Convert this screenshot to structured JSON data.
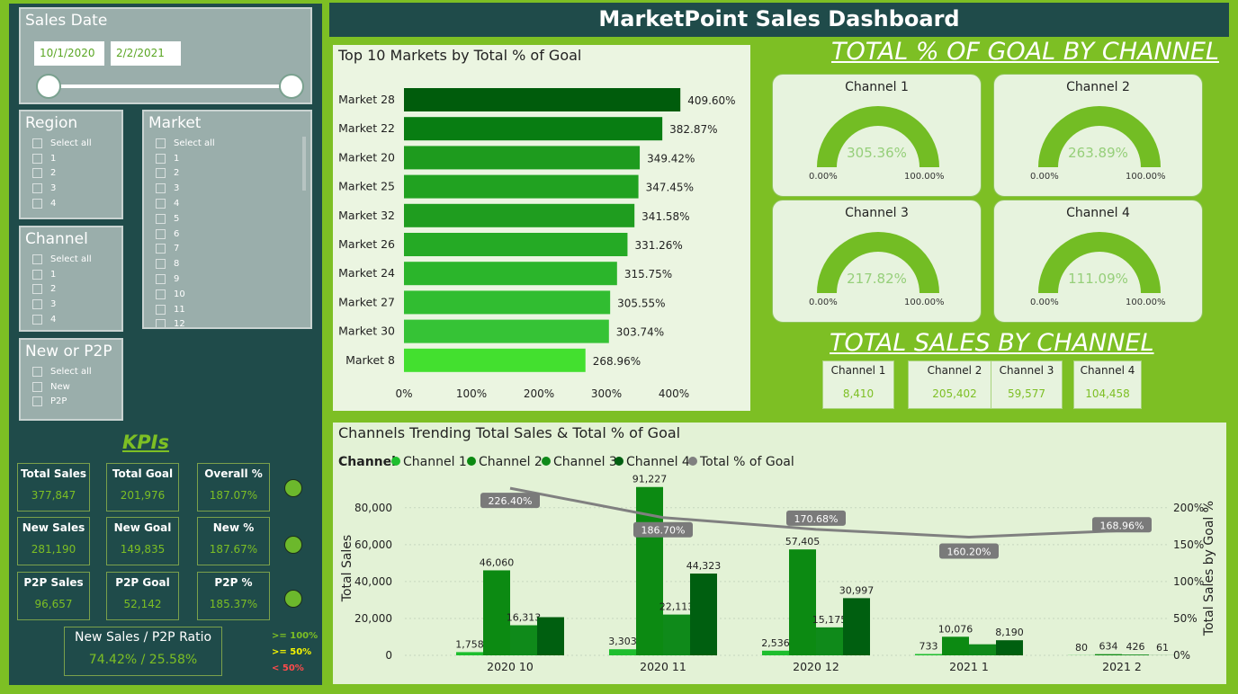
{
  "header": {
    "title": "MarketPoint Sales Dashboard"
  },
  "sales_date": {
    "title": "Sales Date",
    "start": "10/1/2020",
    "end": "2/2/2021"
  },
  "region": {
    "title": "Region",
    "options": [
      "Select all",
      "1",
      "2",
      "3",
      "4"
    ]
  },
  "market": {
    "title": "Market",
    "options": [
      "Select all",
      "1",
      "2",
      "3",
      "4",
      "5",
      "6",
      "7",
      "8",
      "9",
      "10",
      "11",
      "12"
    ]
  },
  "channel": {
    "title": "Channel",
    "options": [
      "Select all",
      "1",
      "2",
      "3",
      "4"
    ]
  },
  "new_p2p": {
    "title": "New or P2P",
    "options": [
      "Select all",
      "New",
      "P2P"
    ]
  },
  "kpis": {
    "title": "KPIs",
    "total_sales_label": "Total Sales",
    "total_sales": "377,847",
    "total_goal_label": "Total Goal",
    "total_goal": "201,976",
    "overall_pct_label": "Overall %",
    "overall_pct": "187.07%",
    "new_sales_label": "New Sales",
    "new_sales": "281,190",
    "new_goal_label": "New Goal",
    "new_goal": "149,835",
    "new_pct_label": "New %",
    "new_pct": "187.67%",
    "p2p_sales_label": "P2P Sales",
    "p2p_sales": "96,657",
    "p2p_goal_label": "P2P Goal",
    "p2p_goal": "52,142",
    "p2p_pct_label": "P2P %",
    "p2p_pct": "185.37%",
    "ratio_label": "New Sales / P2P Ratio",
    "ratio": "74.42% / 25.58%",
    "legend": [
      ">= 100%",
      ">= 50%",
      "< 50%"
    ],
    "legend_colors": [
      "#7dbf24",
      "#f5f500",
      "#ff4b4b"
    ]
  },
  "goal_by_channel": {
    "title": "TOTAL % OF GOAL BY CHANNEL",
    "min_label": "0.00%",
    "max_label": "100.00%",
    "gauges": [
      {
        "name": "Channel 1",
        "value": "305.36%"
      },
      {
        "name": "Channel 2",
        "value": "263.89%"
      },
      {
        "name": "Channel 3",
        "value": "217.82%"
      },
      {
        "name": "Channel 4",
        "value": "111.09%"
      }
    ]
  },
  "sales_by_channel": {
    "title": "TOTAL SALES BY CHANNEL",
    "items": [
      {
        "name": "Channel 1",
        "value": "8,410"
      },
      {
        "name": "Channel 2",
        "value": "205,402"
      },
      {
        "name": "Channel 3",
        "value": "59,577"
      },
      {
        "name": "Channel 4",
        "value": "104,458"
      }
    ]
  },
  "colors": {
    "accent": "#7dbf24",
    "dark": "#1f4b4a",
    "goal_line": "#808080"
  },
  "chart_data": [
    {
      "type": "bar",
      "orientation": "horizontal",
      "title": "Top 10 Markets by Total % of Goal",
      "categories": [
        "Market 28",
        "Market 22",
        "Market 20",
        "Market 25",
        "Market 32",
        "Market 26",
        "Market 24",
        "Market 27",
        "Market 30",
        "Market 8"
      ],
      "values": [
        409.6,
        382.87,
        349.42,
        347.45,
        341.58,
        331.26,
        315.75,
        305.55,
        303.74,
        268.96
      ],
      "labels": [
        "409.60%",
        "382.87%",
        "349.42%",
        "347.45%",
        "341.58%",
        "331.26%",
        "315.75%",
        "305.55%",
        "303.74%",
        "268.96%"
      ],
      "xlim": [
        0,
        400
      ],
      "xticks": [
        "0%",
        "100%",
        "200%",
        "300%",
        "400%"
      ],
      "colors": [
        "#005c0c",
        "#087d12",
        "#1e9b1e",
        "#21a221",
        "#1f9d1f",
        "#25aa25",
        "#2bb52b",
        "#31bd31",
        "#36c336",
        "#43e02f"
      ]
    },
    {
      "type": "bar",
      "title": "Channels Trending Total Sales & Total % of Goal",
      "legend_title": "Channel",
      "legend_placement": "top-left",
      "categories": [
        "2020 10",
        "2020 11",
        "2020 12",
        "2021 1",
        "2021 2"
      ],
      "series": [
        {
          "name": "Channel 1",
          "color": "#1ebe2e",
          "values": [
            1758,
            3303,
            2536,
            733,
            80
          ]
        },
        {
          "name": "Channel 2",
          "color": "#0c8a12",
          "values": [
            46060,
            91227,
            57405,
            10076,
            634
          ]
        },
        {
          "name": "Channel 3",
          "color": "#0f8a1a",
          "values": [
            16313,
            22113,
            15175,
            6000,
            426
          ]
        },
        {
          "name": "Channel 4",
          "color": "#005f10",
          "values": [
            20700,
            44323,
            30997,
            8190,
            61
          ]
        }
      ],
      "bar_labels": [
        [
          "1,758",
          "46,060",
          "16,313",
          ""
        ],
        [
          "3,303",
          "91,227",
          "22,113",
          "44,323"
        ],
        [
          "2,536",
          "57,405",
          "15,175",
          "30,997"
        ],
        [
          "733",
          "10,076",
          "",
          "8,190"
        ],
        [
          "80",
          "634",
          "426",
          "61"
        ]
      ],
      "line": {
        "name": "Total % of Goal",
        "values": [
          226.4,
          186.7,
          170.68,
          160.2,
          168.96
        ],
        "labels": [
          "226.40%",
          "186.70%",
          "170.68%",
          "160.20%",
          "168.96%"
        ]
      },
      "ylabel": "Total Sales",
      "y2label": "Total Sales by Goal %",
      "ylim": [
        0,
        95000
      ],
      "yticks": [
        "0",
        "20,000",
        "40,000",
        "60,000",
        "80,000"
      ],
      "y2lim": [
        0,
        237.5
      ],
      "y2ticks": [
        "0%",
        "50%",
        "100%",
        "150%",
        "200%"
      ]
    }
  ]
}
